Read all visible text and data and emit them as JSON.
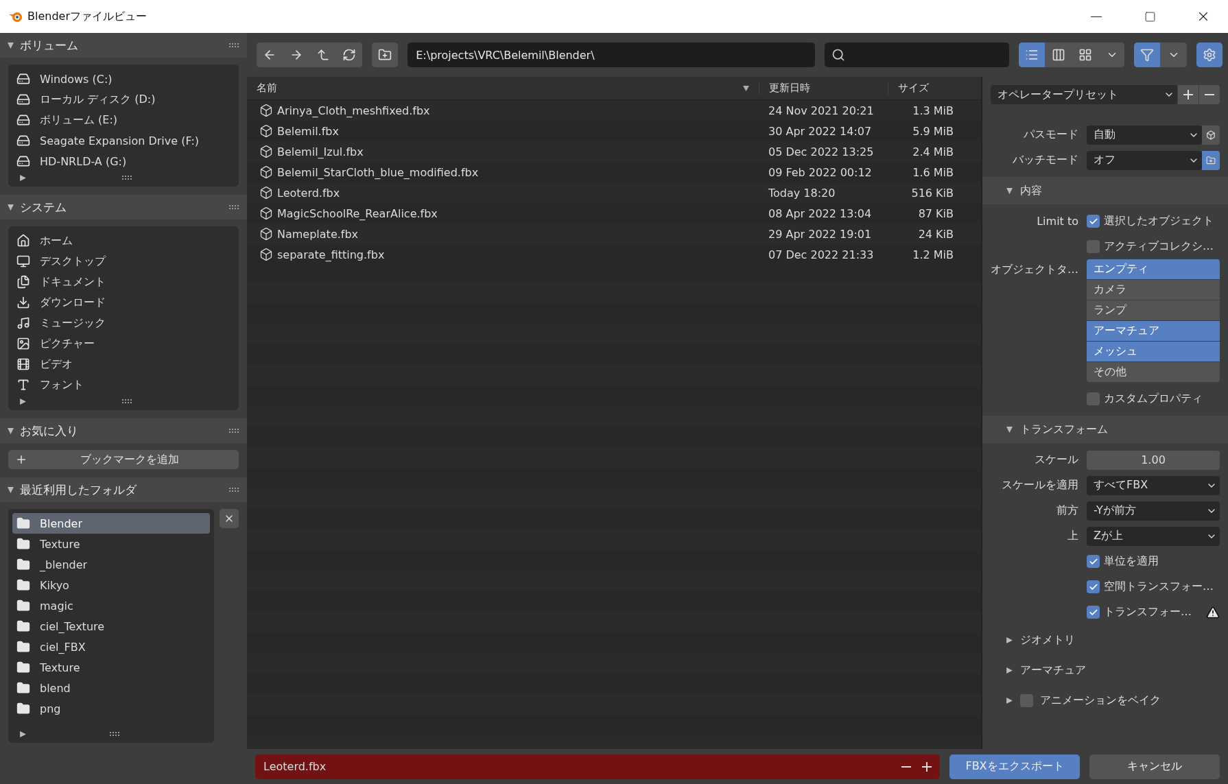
{
  "window": {
    "title": "Blenderファイルビュー"
  },
  "sidebar": [
    {
      "kind": "volumes",
      "title": "ボリューム",
      "expanded": true,
      "items": [
        {
          "label": "Windows (C:)"
        },
        {
          "label": "ローカル ディスク (D:)"
        },
        {
          "label": "ボリューム (E:)"
        },
        {
          "label": "Seagate Expansion Drive (F:)"
        },
        {
          "label": "HD-NRLD-A (G:)"
        }
      ]
    },
    {
      "kind": "system",
      "title": "システム",
      "expanded": true,
      "items": [
        {
          "label": "ホーム"
        },
        {
          "label": "デスクトップ"
        },
        {
          "label": "ドキュメント"
        },
        {
          "label": "ダウンロード"
        },
        {
          "label": "ミュージック"
        },
        {
          "label": "ピクチャー"
        },
        {
          "label": "ビデオ"
        },
        {
          "label": "フォント"
        }
      ]
    },
    {
      "kind": "bookmarks",
      "title": "お気に入り",
      "expanded": true,
      "button": "ブックマークを追加"
    },
    {
      "kind": "recent",
      "title": "最近利用したフォルダ",
      "expanded": true,
      "items": [
        {
          "label": "Blender",
          "selected": true
        },
        {
          "label": "Texture",
          "selected": false
        },
        {
          "label": "_blender",
          "selected": false
        },
        {
          "label": "Kikyo",
          "selected": false
        },
        {
          "label": "magic",
          "selected": false
        },
        {
          "label": "ciel_Texture",
          "selected": false
        },
        {
          "label": "ciel_FBX",
          "selected": false
        },
        {
          "label": "Texture",
          "selected": false
        },
        {
          "label": "blend",
          "selected": false
        },
        {
          "label": "png",
          "selected": false
        }
      ]
    }
  ],
  "toolbar": {
    "path": "E:\\projects\\VRC\\Belemil\\Blender\\",
    "view_modes": [
      {
        "kind": "list",
        "selected": true
      },
      {
        "kind": "columns",
        "selected": false
      },
      {
        "kind": "grid",
        "selected": false
      }
    ],
    "filter": {
      "on": true
    }
  },
  "file_list": {
    "columns": [
      "名前",
      "更新日時",
      "サイズ"
    ],
    "rows": [
      {
        "name": "Arinya_Cloth_meshfixed.fbx",
        "modified": "24 Nov 2021 20:21",
        "size": "1.3 MiB"
      },
      {
        "name": "Belemil.fbx",
        "modified": "30 Apr 2022 14:07",
        "size": "5.9 MiB"
      },
      {
        "name": "Belemil_Izul.fbx",
        "modified": "05 Dec 2022 13:25",
        "size": "2.4 MiB"
      },
      {
        "name": "Belemil_StarCloth_blue_modified.fbx",
        "modified": "09 Feb 2022 00:12",
        "size": "1.6 MiB"
      },
      {
        "name": "Leoterd.fbx",
        "modified": "Today 18:20",
        "size": "516 KiB"
      },
      {
        "name": "MagicSchoolRe_RearAlice.fbx",
        "modified": "08 Apr 2022 13:04",
        "size": "87 KiB"
      },
      {
        "name": "Nameplate.fbx",
        "modified": "29 Apr 2022 19:01",
        "size": "24 KiB"
      },
      {
        "name": "separate_fitting.fbx",
        "modified": "07 Dec 2022 21:33",
        "size": "1.2 MiB"
      }
    ]
  },
  "settings": {
    "preset": "オペレータープリセット",
    "rows": [
      {
        "kind": "dropdown",
        "label": "パスモード",
        "value": "自動",
        "side_on": false
      },
      {
        "kind": "dropdown",
        "label": "バッチモード",
        "value": "オフ",
        "side_on": true
      },
      {
        "kind": "section",
        "title": "内容",
        "expanded": true
      },
      {
        "kind": "checkbox",
        "label": "Limit to",
        "text": "選択したオブジェクト",
        "checked": true
      },
      {
        "kind": "checkbox",
        "text": "アクティブコレクシ…",
        "checked": false
      },
      {
        "kind": "multiselect",
        "label": "オブジェクトタ…",
        "options": [
          {
            "label": "エンプティ",
            "selected": true
          },
          {
            "label": "カメラ",
            "selected": false
          },
          {
            "label": "ランプ",
            "selected": false
          },
          {
            "label": "アーマチュア",
            "selected": true
          },
          {
            "label": "メッシュ",
            "selected": true
          },
          {
            "label": "その他",
            "selected": false
          }
        ]
      },
      {
        "kind": "checkbox",
        "text": "カスタムプロパティ",
        "checked": false
      },
      {
        "kind": "section",
        "title": "トランスフォーム",
        "expanded": true
      },
      {
        "kind": "number",
        "label": "スケール",
        "value": "1.00"
      },
      {
        "kind": "dropdown",
        "label": "スケールを適用",
        "value": "すべてFBX"
      },
      {
        "kind": "dropdown",
        "label": "前方",
        "value": "-Yが前方"
      },
      {
        "kind": "dropdown",
        "label": "上",
        "value": "Zが上"
      },
      {
        "kind": "checkbox",
        "text": "単位を適用",
        "checked": true
      },
      {
        "kind": "checkbox",
        "text": "空間トランスフォー…",
        "checked": true
      },
      {
        "kind": "checkbox",
        "text": "トランスフォー…",
        "checked": true,
        "warning": true
      },
      {
        "kind": "section",
        "title": "ジオメトリ",
        "expanded": false
      },
      {
        "kind": "section",
        "title": "アーマチュア",
        "expanded": false
      },
      {
        "kind": "section",
        "title": "アニメーションをベイク",
        "expanded": false,
        "checked": false
      }
    ]
  },
  "footer": {
    "filename": "Leoterd.fbx",
    "confirm": "FBXをエクスポート",
    "cancel": "キャンセル"
  }
}
